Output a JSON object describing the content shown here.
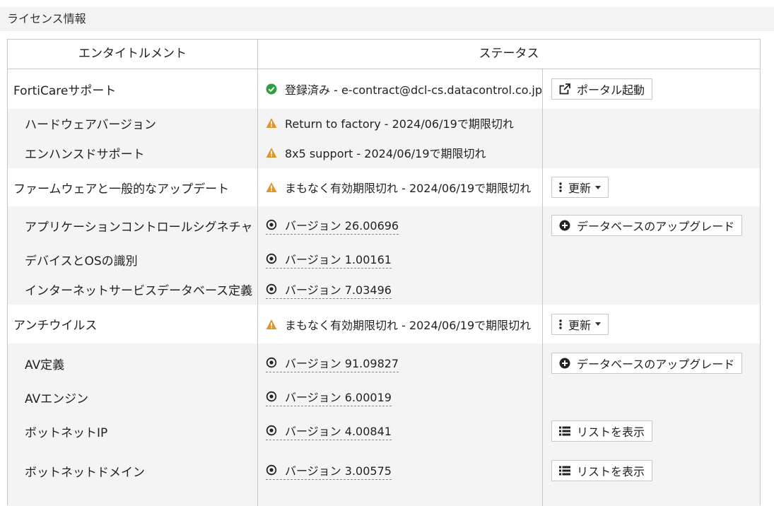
{
  "section": {
    "title": "ライセンス情報"
  },
  "table": {
    "columns": [
      "エンタイトルメント",
      "ステータス"
    ],
    "rows": [
      {
        "name": "FortiCareサポート",
        "status": "登録済み - e-contract@dcl-cs.datacontrol.co.jp",
        "status_icon": "check-circle-icon",
        "action": "ポータル起動",
        "action_icon": "external-link-icon"
      },
      {
        "name": "ハードウェアバージョン",
        "status": "Return to factory - 2024/06/19で期限切れ",
        "status_icon": "warning-icon"
      },
      {
        "name": "エンハンスドサポート",
        "status": "8x5 support - 2024/06/19で期限切れ",
        "status_icon": "warning-icon"
      },
      {
        "name": "ファームウェアと一般的なアップデート",
        "status": "まもなく有効期限切れ - 2024/06/19で期限切れ",
        "status_icon": "warning-icon",
        "action": "更新",
        "action_icon": "kebab-icon"
      },
      {
        "name": "アプリケーションコントロールシグネチャ",
        "status": "バージョン 26.00696",
        "status_icon": "target-icon",
        "action": "データベースのアップグレード",
        "action_icon": "plus-circle-icon"
      },
      {
        "name": "デバイスとOSの識別",
        "status": "バージョン 1.00161",
        "status_icon": "target-icon"
      },
      {
        "name": "インターネットサービスデータベース定義",
        "status": "バージョン 7.03496",
        "status_icon": "target-icon"
      },
      {
        "name": "アンチウイルス",
        "status": "まもなく有効期限切れ - 2024/06/19で期限切れ",
        "status_icon": "warning-icon",
        "action": "更新",
        "action_icon": "kebab-icon"
      },
      {
        "name": "AV定義",
        "status": "バージョン 91.09827",
        "status_icon": "target-icon",
        "action": "データベースのアップグレード",
        "action_icon": "plus-circle-icon"
      },
      {
        "name": "AVエンジン",
        "status": "バージョン 6.00019",
        "status_icon": "target-icon"
      },
      {
        "name": "ボットネットIP",
        "status": "バージョン 4.00841",
        "status_icon": "target-icon",
        "action": "リストを表示",
        "action_icon": "list-icon"
      },
      {
        "name": "ボットネットドメイン",
        "status": "バージョン 3.00575",
        "status_icon": "target-icon",
        "action": "リストを表示",
        "action_icon": "list-icon"
      }
    ]
  },
  "colors": {
    "ok": "#2e9e3e",
    "warning": "#e0952b",
    "border": "#c8c8c8",
    "row_gray": "#f4f4f4"
  }
}
